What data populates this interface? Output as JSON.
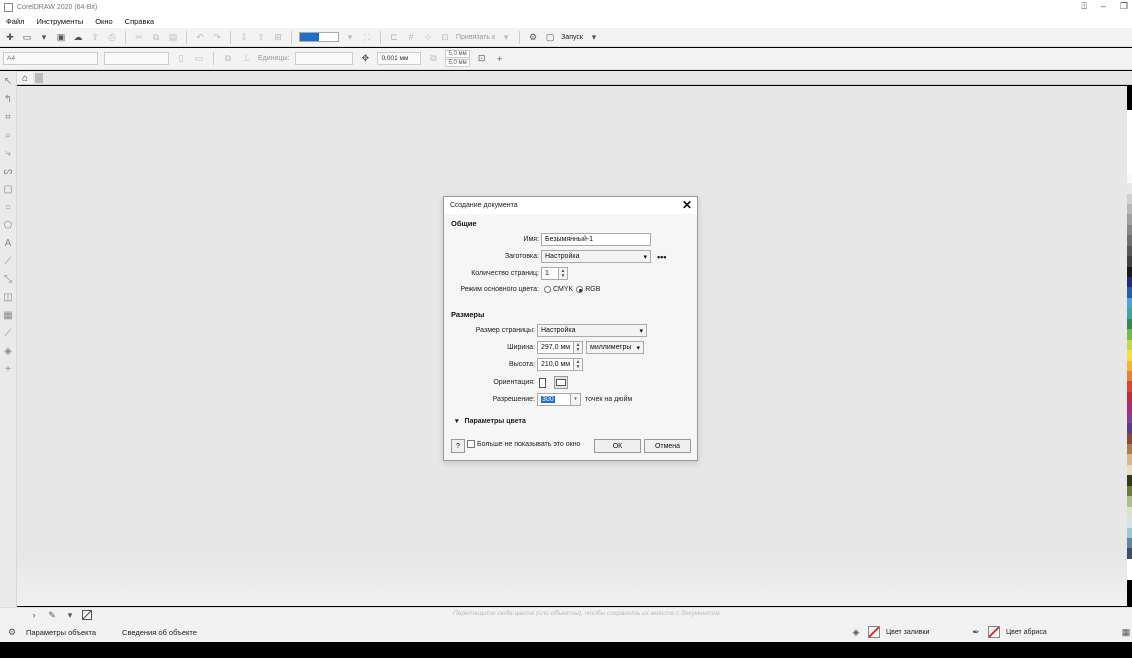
{
  "window": {
    "title": "CorelDRAW 2020 (64-Bit)"
  },
  "menu": [
    "Файл",
    "Инструменты",
    "Окно",
    "Справка"
  ],
  "toolbar": {
    "zoom_input": "",
    "snap_label": "Привязать к",
    "launch_label": "Запуск"
  },
  "propbar": {
    "units_label": "Единицы:",
    "nudge_value": "0,001 мм",
    "dup_x": "5,0 мм",
    "dup_y": "5,0 мм"
  },
  "docbar": {
    "hint": "Перетащите сюда цвета (или объекты), чтобы сохранить их вместе с документом"
  },
  "status": {
    "object_props": "Параметры объекта",
    "object_info": "Сведения об объекте",
    "fill_color": "Цвет заливки",
    "outline_color": "Цвет абриса"
  },
  "dialog": {
    "title": "Создание документа",
    "general_section": "Общие",
    "name_label": "Имя:",
    "name_value": "Безымянный-1",
    "preset_label": "Заготовка:",
    "preset_value": "Настройка",
    "pages_label": "Количество страниц:",
    "pages_value": "1",
    "color_mode_label": "Режим основного цвета:",
    "cmyk": "CMYK",
    "rgb": "RGB",
    "color_mode_selected": "RGB",
    "size_section": "Размеры",
    "page_size_label": "Размер страницы:",
    "page_size_value": "Настройка",
    "width_label": "Ширина:",
    "width_value": "297,0 мм",
    "units_value": "миллиметры",
    "height_label": "Высота:",
    "height_value": "210,0 мм",
    "orientation_label": "Ориентация:",
    "orientation_selected": "landscape",
    "resolution_label": "Разрешение:",
    "resolution_value": "300",
    "resolution_units": "точек на дюйм",
    "color_params": "Параметры цвета",
    "help": "?",
    "dont_show": "Больше не показывать это окно",
    "ok": "ОК",
    "cancel": "Отмена"
  },
  "colors": {
    "accent": "#1d6fc8",
    "palette": [
      "#ffffff",
      "#ffffff",
      "#ffffff",
      "#ffffff",
      "#ffffff",
      "#ffffff",
      "#f8f8f8",
      "#e8e8e8",
      "#d0d0d0",
      "#b8b8b8",
      "#a0a0a0",
      "#888888",
      "#707070",
      "#585858",
      "#404040",
      "#1a1a1a",
      "#1e2c7a",
      "#1f5fb5",
      "#4ba3dd",
      "#3aa8a0",
      "#2e8b57",
      "#6cbf45",
      "#c7d93b",
      "#f4e13a",
      "#f9b233",
      "#f07f2a",
      "#e8432a",
      "#c9283e",
      "#b8247a",
      "#8b3b98",
      "#5a3b96",
      "#8a4b2a",
      "#b07a4a",
      "#d8b78a",
      "#ebdcc0",
      "#2f3b1c",
      "#6e7c3a",
      "#a9c28a",
      "#d4e8c5",
      "#cfe6ef",
      "#9fc5da",
      "#5c87a9",
      "#3c4f6a",
      "#ffffff",
      "#ffffff"
    ]
  }
}
